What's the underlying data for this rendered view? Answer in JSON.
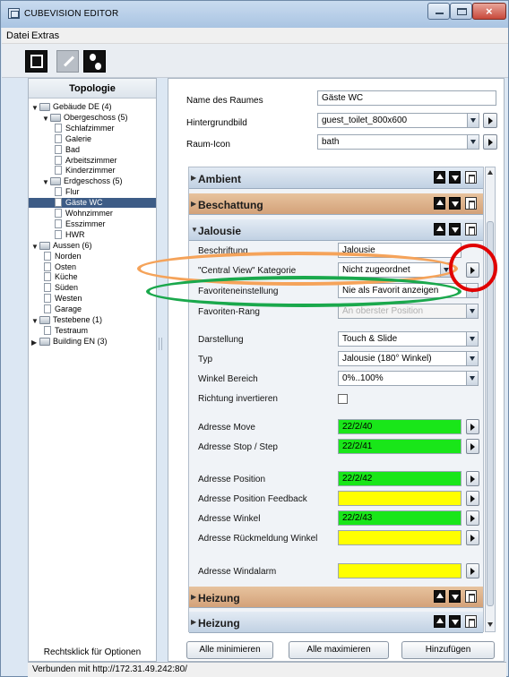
{
  "window": {
    "title": "CUBEVISION EDITOR"
  },
  "menu": {
    "items": [
      "Datei",
      "Extras"
    ]
  },
  "toolbar": {
    "icons": [
      "save-icon",
      "edit-icon",
      "user-icon"
    ]
  },
  "left_panel": {
    "header": "Topologie",
    "footer": "Rechtsklick für Optionen",
    "tree": [
      {
        "label": "Gebäude DE (4)",
        "type": "folder",
        "expanded": true
      },
      {
        "label": "Obergeschoss (5)",
        "type": "folder",
        "expanded": true
      },
      {
        "label": "Schlafzimmer",
        "type": "room"
      },
      {
        "label": "Galerie",
        "type": "room"
      },
      {
        "label": "Bad",
        "type": "room"
      },
      {
        "label": "Arbeitszimmer",
        "type": "room"
      },
      {
        "label": "Kinderzimmer",
        "type": "room"
      },
      {
        "label": "Erdgeschoss (5)",
        "type": "folder",
        "expanded": true
      },
      {
        "label": "Flur",
        "type": "room"
      },
      {
        "label": "Gäste WC",
        "type": "room",
        "selected": true
      },
      {
        "label": "Wohnzimmer",
        "type": "room"
      },
      {
        "label": "Esszimmer",
        "type": "room"
      },
      {
        "label": "HWR",
        "type": "room"
      },
      {
        "label": "Aussen (6)",
        "type": "folder",
        "expanded": true
      },
      {
        "label": "Norden",
        "type": "room"
      },
      {
        "label": "Osten",
        "type": "room"
      },
      {
        "label": "Küche",
        "type": "room"
      },
      {
        "label": "Süden",
        "type": "room"
      },
      {
        "label": "Westen",
        "type": "room"
      },
      {
        "label": "Garage",
        "type": "room"
      },
      {
        "label": "Testebene (1)",
        "type": "folder",
        "expanded": true
      },
      {
        "label": "Testraum",
        "type": "room"
      },
      {
        "label": "Building EN (3)",
        "type": "folder",
        "expanded": false
      }
    ]
  },
  "room": {
    "name_label": "Name des Raumes",
    "name_value": "Gäste WC",
    "background_label": "Hintergrundbild",
    "background_value": "guest_toilet_800x600",
    "icon_label": "Raum-Icon",
    "icon_value": "bath"
  },
  "panels": [
    {
      "title": "Ambient",
      "color": "blue",
      "expanded": false
    },
    {
      "title": "Beschattung",
      "color": "orange",
      "expanded": false
    },
    {
      "title": "Jalousie",
      "color": "blue",
      "expanded": true
    },
    {
      "title": "Heizung",
      "color": "orange",
      "expanded": false
    },
    {
      "title": "Heizung",
      "color": "blue",
      "expanded": false
    }
  ],
  "jalousie": {
    "beschriftung_label": "Beschriftung",
    "beschriftung_value": "Jalousie",
    "kategorie_label": "\"Central View\" Kategorie",
    "kategorie_value": "Nicht zugeordnet",
    "favorit_label": "Favoriteneinstellung",
    "favorit_value": "Nie als Favorit anzeigen",
    "rang_label": "Favoriten-Rang",
    "rang_value": "An oberster Position",
    "darstellung_label": "Darstellung",
    "darstellung_value": "Touch & Slide",
    "typ_label": "Typ",
    "typ_value": "Jalousie (180° Winkel)",
    "winkel_label": "Winkel Bereich",
    "winkel_value": "0%..100%",
    "richtung_label": "Richtung invertieren",
    "move_label": "Adresse Move",
    "move_value": "22/2/40",
    "stop_label": "Adresse Stop / Step",
    "stop_value": "22/2/41",
    "position_label": "Adresse Position",
    "position_value": "22/2/42",
    "pos_feedback_label": "Adresse Position Feedback",
    "pos_feedback_value": "",
    "winkel_addr_label": "Adresse Winkel",
    "winkel_addr_value": "22/2/43",
    "winkel_feedback_label": "Adresse Rückmeldung Winkel",
    "winkel_feedback_value": "",
    "windalarm_label": "Adresse Windalarm",
    "windalarm_value": ""
  },
  "buttons": {
    "minimize_all": "Alle minimieren",
    "maximize_all": "Alle maximieren",
    "add": "Hinzufügen"
  },
  "status": {
    "text": "Verbunden mit http://172.31.49.242:80/"
  },
  "colors": {
    "green": "#19e619",
    "yellow": "#ffff00",
    "annotation_orange": "#f5a35a",
    "annotation_green": "#1aa84c",
    "annotation_red": "#e00000",
    "selection": "#3d5c86"
  }
}
